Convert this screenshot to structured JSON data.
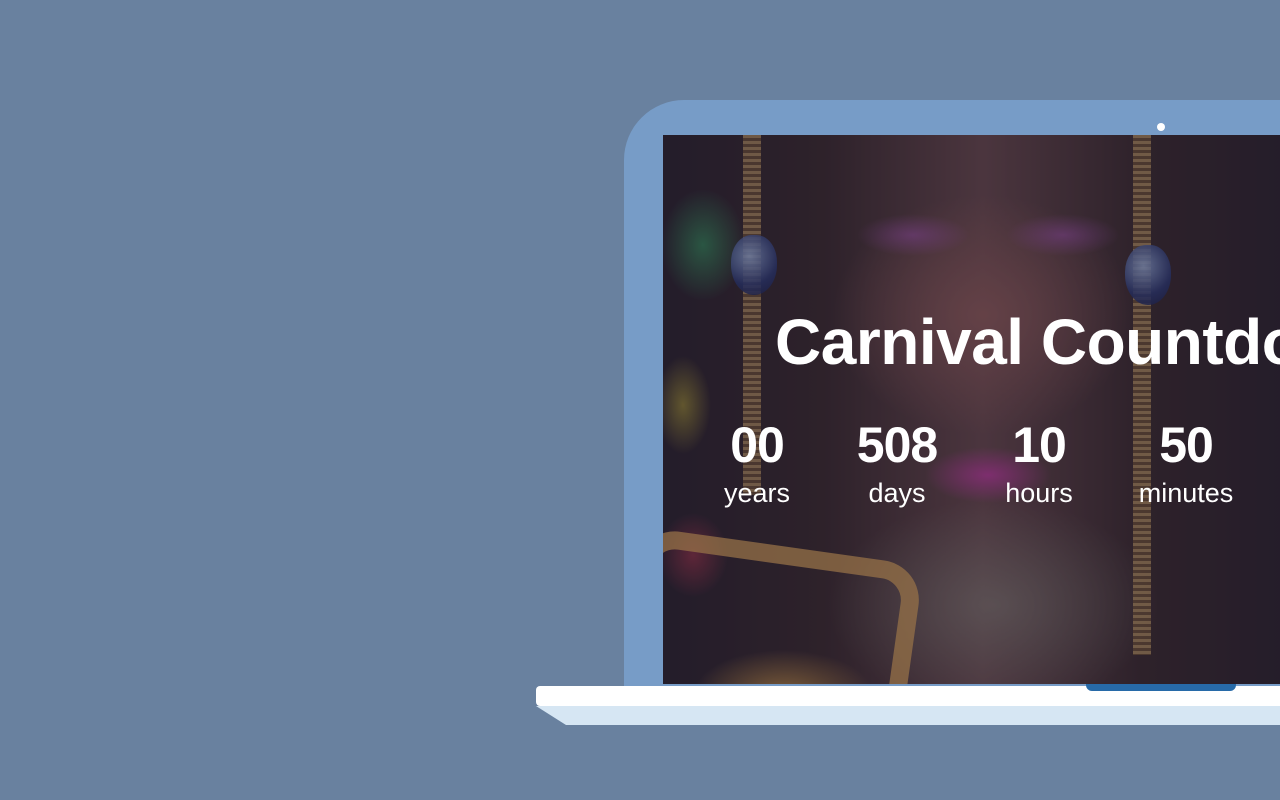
{
  "countdown": {
    "title": "Carnival Countdown",
    "units": [
      {
        "value": "00",
        "label": "years"
      },
      {
        "value": "508",
        "label": "days"
      },
      {
        "value": "10",
        "label": "hours"
      },
      {
        "value": "50",
        "label": "minutes"
      }
    ]
  },
  "colors": {
    "background": "#69819f",
    "laptop_bezel": "#779cc7",
    "laptop_base": "#ffffff",
    "laptop_foot": "#d6e6f3",
    "accent": "#276aa8",
    "text": "#ffffff"
  },
  "icons": {
    "camera": "camera-dot-icon"
  }
}
